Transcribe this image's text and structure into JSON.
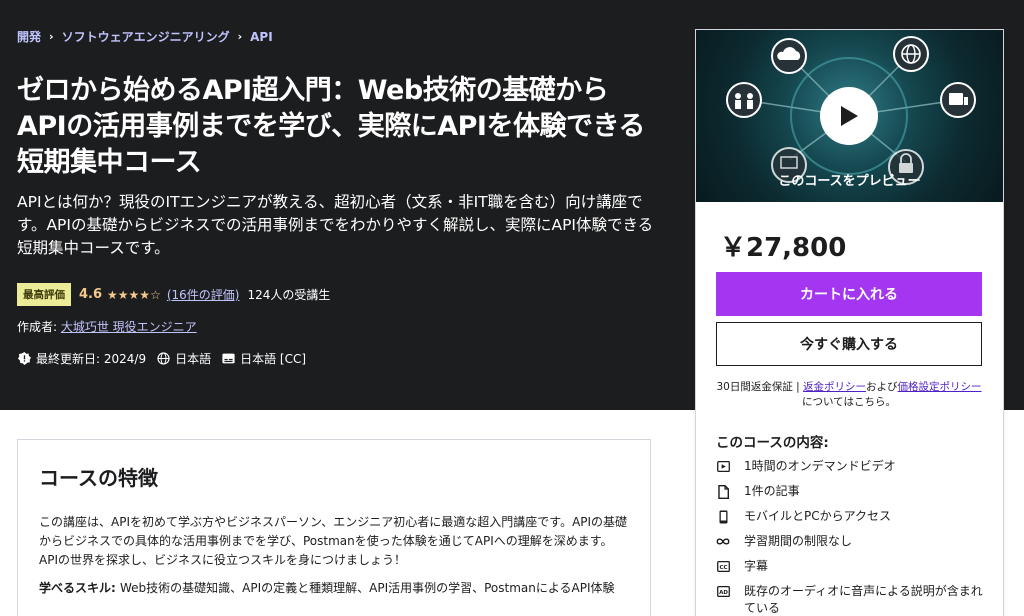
{
  "breadcrumb": [
    "開発",
    "ソフトウェアエンジニアリング",
    "API"
  ],
  "course": {
    "title": "ゼロから始めるAPI超入門：Web技術の基礎からAPIの活用事例までを学び、実際にAPIを体験できる短期集中コース",
    "subtitle": "APIとは何か？現役のITエンジニアが教える、超初心者（文系・非IT職を含む）向け講座です。APIの基礎からビジネスでの活用事例までをわかりやすく解説し、実際にAPI体験できる短期集中コースです。",
    "badge": "最高評価",
    "rating": "4.6",
    "stars": "★★★★☆",
    "reviews": "(16件の評価)",
    "students": "124人の受講生",
    "author_prefix": "作成者: ",
    "author": "大城巧世 現役エンジニア",
    "last_updated": "最終更新日: 2024/9",
    "language": "日本語",
    "captions": "日本語 [CC]"
  },
  "sidebar": {
    "preview_label": "このコースをプレビュー",
    "price": "￥27,800",
    "cart_button": "カートに入れる",
    "buy_button": "今すぐ購入する",
    "guarantee_prefix": "30日間返金保証 | ",
    "refund_policy": "返金ポリシー",
    "and": "および",
    "pricing_policy": "価格設定ポリシー",
    "guarantee_suffix": "についてはこちら。",
    "includes_title": "このコースの内容:",
    "includes": [
      {
        "icon": "video-icon",
        "label": "1時間のオンデマンドビデオ"
      },
      {
        "icon": "article-icon",
        "label": "1件の記事"
      },
      {
        "icon": "mobile-icon",
        "label": "モバイルとPCからアクセス"
      },
      {
        "icon": "infinity-icon",
        "label": "学習期間の制限なし"
      },
      {
        "icon": "captions-icon",
        "label": "字幕"
      },
      {
        "icon": "audio-description-icon",
        "label": "既存のオーディオに音声による説明が含まれている"
      }
    ]
  },
  "features": {
    "heading": "コースの特徴",
    "description": "この講座は、APIを初めて学ぶ方やビジネスパーソン、エンジニア初心者に最適な超入門講座です。APIの基礎からビジネスでの具体的な活用事例までを学び、Postmanを使った体験を通じてAPIへの理解を深めます。APIの世界を探求し、ビジネスに役立つスキルを身につけましょう！",
    "skills_label": "学べるスキル: ",
    "skills": "Web技術の基礎知識、APIの定義と種類理解、API活用事例の学習、PostmanによるAPI体験"
  },
  "colors": {
    "hero_bg": "#1c1d1f",
    "link": "#c0c4fc",
    "star": "#f3ca8c",
    "cart": "#a435f0"
  }
}
